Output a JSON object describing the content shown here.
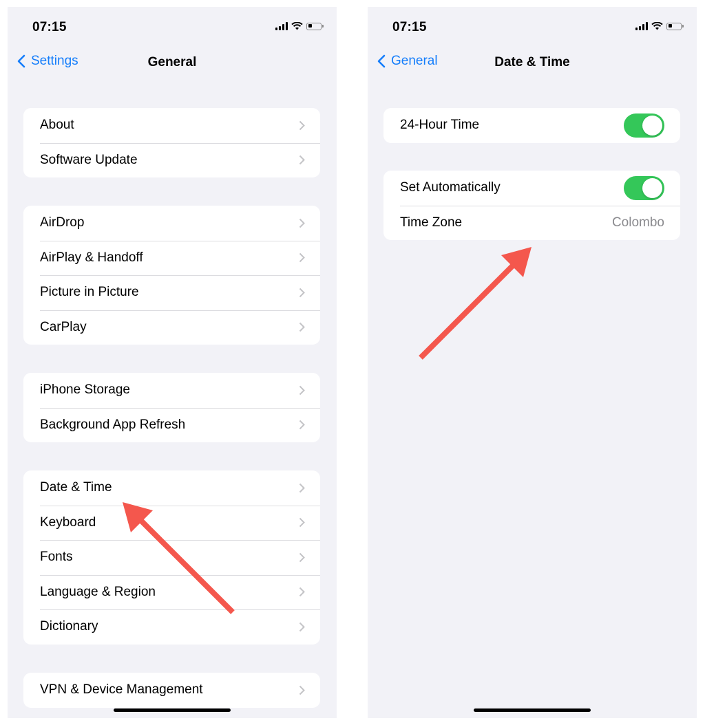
{
  "left_screen": {
    "status_bar": {
      "time": "07:15",
      "icons": [
        "cellular-signal-icon",
        "wifi-icon",
        "battery-icon"
      ]
    },
    "nav": {
      "back_label": "Settings",
      "title": "General"
    },
    "groups": [
      {
        "items": [
          {
            "label": "About"
          },
          {
            "label": "Software Update"
          }
        ]
      },
      {
        "items": [
          {
            "label": "AirDrop"
          },
          {
            "label": "AirPlay & Handoff"
          },
          {
            "label": "Picture in Picture"
          },
          {
            "label": "CarPlay"
          }
        ]
      },
      {
        "items": [
          {
            "label": "iPhone Storage"
          },
          {
            "label": "Background App Refresh"
          }
        ]
      },
      {
        "items": [
          {
            "label": "Date & Time"
          },
          {
            "label": "Keyboard"
          },
          {
            "label": "Fonts"
          },
          {
            "label": "Language & Region"
          },
          {
            "label": "Dictionary"
          }
        ]
      },
      {
        "items": [
          {
            "label": "VPN & Device Management"
          }
        ]
      }
    ],
    "annotation": {
      "type": "arrow",
      "points_to": "Date & Time",
      "color": "#f4574d"
    }
  },
  "right_screen": {
    "status_bar": {
      "time": "07:15",
      "icons": [
        "cellular-signal-icon",
        "wifi-icon",
        "battery-icon"
      ]
    },
    "nav": {
      "back_label": "General",
      "title": "Date & Time"
    },
    "groups": [
      {
        "items": [
          {
            "label": "24-Hour Time",
            "toggle": true
          }
        ]
      },
      {
        "items": [
          {
            "label": "Set Automatically",
            "toggle": true
          },
          {
            "label": "Time Zone",
            "value": "Colombo"
          }
        ]
      }
    ],
    "annotation": {
      "type": "arrow",
      "points_to": "Time Zone",
      "color": "#f4574d"
    }
  },
  "colors": {
    "accent": "#157efb",
    "toggle_on": "#34c759",
    "background": "#f2f2f7",
    "annotation": "#f4574d"
  }
}
